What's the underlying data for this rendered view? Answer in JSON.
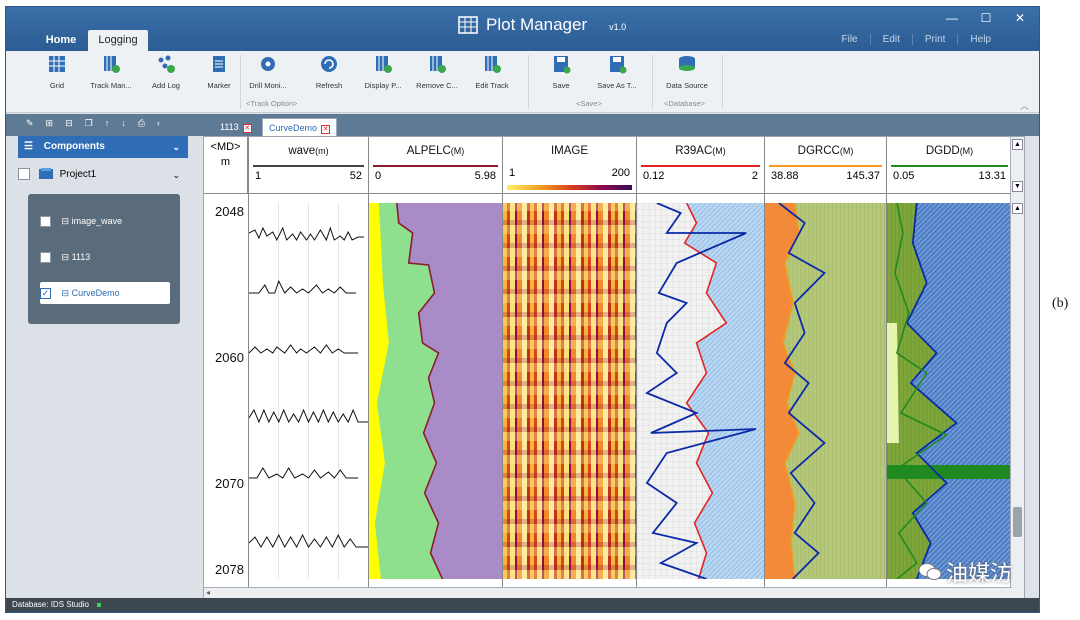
{
  "window": {
    "title": "Plot Manager",
    "version": "v1.0",
    "minimize": "—",
    "maximize": "☐",
    "close": "✕"
  },
  "menu": [
    "File",
    "Edit",
    "Print",
    "Help"
  ],
  "ribbon_tabs": [
    "Home",
    "Logging"
  ],
  "ribbon": {
    "buttons": [
      "Grid",
      "Track Man...",
      "Add Log",
      "Marker",
      "Drill Moni...",
      "Refresh",
      "Display P...",
      "Remove C...",
      "Edit Track",
      "Save",
      "Save As T...",
      "Data Source"
    ],
    "groups": [
      "<Track Option>",
      "<Save>",
      "<Database>"
    ]
  },
  "doc_tabs": [
    "1113",
    "CurveDemo"
  ],
  "sidebar": {
    "header": "Components",
    "project": "Project1",
    "items": [
      "image_wave",
      "1113",
      "CurveDemo"
    ]
  },
  "depth": {
    "header": "<MD>",
    "unit": "m",
    "labels": [
      "2048",
      "2060",
      "2070",
      "2078"
    ]
  },
  "tracks": [
    {
      "name": "wave",
      "unit": "(m)",
      "min": "1",
      "max": "52",
      "color": "#444444"
    },
    {
      "name": "ALPELC",
      "unit": "(M)",
      "min": "0",
      "max": "5.98",
      "color": "#8b1c2c"
    },
    {
      "name": "IMAGE",
      "unit": "",
      "min": "1",
      "max": "200",
      "color": "#6a0dad"
    },
    {
      "name": "R39AC",
      "unit": "(M)",
      "min": "0.12",
      "max": "2",
      "color": "#e52222"
    },
    {
      "name": "DGRCC",
      "unit": "(M)",
      "min": "38.88",
      "max": "145.37",
      "color": "#f29b1c"
    },
    {
      "name": "DGDD",
      "unit": "(M)",
      "min": "0.05",
      "max": "13.31",
      "color": "#1f8a1f"
    }
  ],
  "status": {
    "database": "Database:  IDS Studio"
  },
  "figure_label": "(b)",
  "watermark": "油媒汸"
}
